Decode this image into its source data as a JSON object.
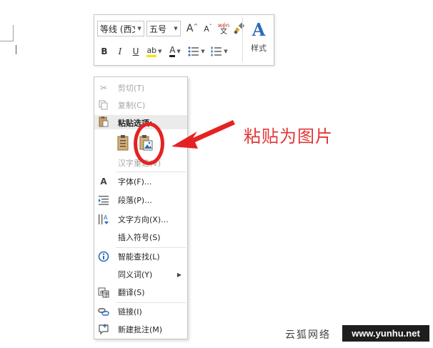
{
  "toolbar": {
    "font_name": "等线 (西文",
    "font_size": "五号",
    "grow_font": "A",
    "shrink_font": "A",
    "phonetic_top": "wén",
    "phonetic_bottom": "文",
    "bold": "B",
    "italic": "I",
    "underline": "U",
    "highlight": "ab",
    "font_color": "A",
    "styles_label": "样式",
    "styles_glyph": "A"
  },
  "menu": {
    "cut": "剪切(T)",
    "copy": "复制(C)",
    "paste_options": "粘贴选项:",
    "hanzi_reselect": "汉字重选(V)",
    "font": "字体(F)...",
    "paragraph": "段落(P)...",
    "text_direction": "文字方向(X)...",
    "insert_symbol": "插入符号(S)",
    "smart_lookup": "智能查找(L)",
    "synonyms": "同义词(Y)",
    "translate": "翻译(S)",
    "link": "链接(I)",
    "new_comment": "新建批注(M)"
  },
  "annotation": {
    "text": "粘贴为图片",
    "color": "#e23636"
  },
  "watermark": {
    "cn": "云狐网络",
    "url": "www.yunhu.net"
  }
}
